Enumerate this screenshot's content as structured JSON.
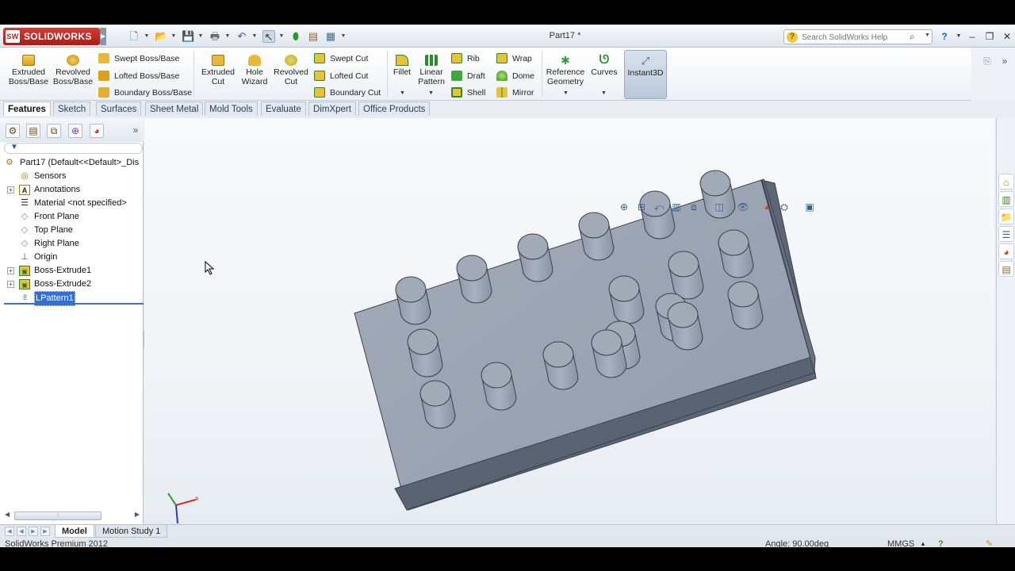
{
  "app": {
    "brand": "SOLIDWORKS",
    "document_title": "Part17 *",
    "help_search_placeholder": "Search SolidWorks Help"
  },
  "ribbon": {
    "extruded_boss": "Extruded\nBoss/Base",
    "revolved_boss": "Revolved\nBoss/Base",
    "swept_boss": "Swept Boss/Base",
    "lofted_boss": "Lofted Boss/Base",
    "boundary_boss": "Boundary Boss/Base",
    "extruded_cut": "Extruded\nCut",
    "hole_wizard": "Hole\nWizard",
    "revolved_cut": "Revolved\nCut",
    "swept_cut": "Swept Cut",
    "lofted_cut": "Lofted Cut",
    "boundary_cut": "Boundary Cut",
    "fillet": "Fillet",
    "linear_pattern": "Linear\nPattern",
    "rib": "Rib",
    "draft": "Draft",
    "shell": "Shell",
    "wrap": "Wrap",
    "dome": "Dome",
    "mirror": "Mirror",
    "reference_geometry": "Reference\nGeometry",
    "curves": "Curves",
    "instant3d": "Instant3D"
  },
  "tabs": [
    "Features",
    "Sketch",
    "Surfaces",
    "Sheet Metal",
    "Mold Tools",
    "Evaluate",
    "DimXpert",
    "Office Products"
  ],
  "tree": {
    "root": "Part17  (Default<<Default>_Dis",
    "items": [
      {
        "label": "Sensors",
        "icon": "sensor-icon",
        "expandable": false
      },
      {
        "label": "Annotations",
        "icon": "annotations-icon",
        "expandable": true
      },
      {
        "label": "Material <not specified>",
        "icon": "material-icon",
        "expandable": false
      },
      {
        "label": "Front Plane",
        "icon": "plane-icon",
        "expandable": false
      },
      {
        "label": "Top Plane",
        "icon": "plane-icon",
        "expandable": false
      },
      {
        "label": "Right Plane",
        "icon": "plane-icon",
        "expandable": false
      },
      {
        "label": "Origin",
        "icon": "origin-icon",
        "expandable": false
      },
      {
        "label": "Boss-Extrude1",
        "icon": "extrude-feature-icon",
        "expandable": true
      },
      {
        "label": "Boss-Extrude2",
        "icon": "extrude-feature-icon",
        "expandable": true
      },
      {
        "label": "LPattern1",
        "icon": "linear-pattern-icon",
        "expandable": false,
        "selected": true
      }
    ]
  },
  "bottom_tabs": [
    "Model",
    "Motion Study 1"
  ],
  "status": {
    "product": "SolidWorks Premium 2012",
    "angle": "Angle: 90.00deg",
    "units": "MMGS"
  },
  "model": {
    "description_pins_rows": 3,
    "plate_color": "#9aa3b2",
    "pin_color": "#a7afbd"
  }
}
